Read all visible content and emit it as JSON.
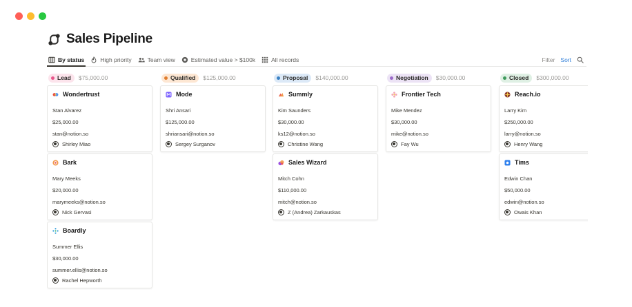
{
  "page": {
    "title": "Sales Pipeline",
    "title_icon": "pipeline-icon"
  },
  "window_controls": {
    "red": "#ff5f57",
    "yellow": "#febc2e",
    "green": "#28c840"
  },
  "views": [
    {
      "label": "By status",
      "icon": "board-icon",
      "active": true
    },
    {
      "label": "High priority",
      "icon": "flame-icon",
      "active": false
    },
    {
      "label": "Team view",
      "icon": "people-icon",
      "active": false
    },
    {
      "label": "Estimated value > $100k",
      "icon": "gear-icon",
      "active": false
    },
    {
      "label": "All records",
      "icon": "grid-icon",
      "active": false
    }
  ],
  "tools": {
    "filter": "Filter",
    "sort": "Sort",
    "search_icon": "search-icon"
  },
  "columns": [
    {
      "status": "Lead",
      "total": "$75,000.00",
      "pill_bg": "#fce4ec",
      "dot": "#e8588c",
      "cards": [
        {
          "name": "Wondertrust",
          "logo": "wondertrust-logo",
          "contact": "Stan Alvarez",
          "value": "$25,000.00",
          "email": "stan@notion.so",
          "owner": "Shirley Miao"
        },
        {
          "name": "Bark",
          "logo": "bark-logo",
          "contact": "Mary Meeks",
          "value": "$20,000.00",
          "email": "marymeeks@notion.so",
          "owner": "Nick Gervasi"
        },
        {
          "name": "Boardly",
          "logo": "boardly-logo",
          "contact": "Summer Ellis",
          "value": "$30,000.00",
          "email": "summer.ellis@notion.so",
          "owner": "Rachel Hepworth"
        }
      ]
    },
    {
      "status": "Qualified",
      "total": "$125,000.00",
      "pill_bg": "#fde7d3",
      "dot": "#e07d2e",
      "cards": [
        {
          "name": "Mode",
          "logo": "mode-logo",
          "contact": "Shri Ansari",
          "value": "$125,000.00",
          "email": "shriansari@notion.so",
          "owner": "Sergey Surganov"
        }
      ]
    },
    {
      "status": "Proposal",
      "total": "$140,000.00",
      "pill_bg": "#dce9f7",
      "dot": "#3b82c4",
      "cards": [
        {
          "name": "Summly",
          "logo": "summly-logo",
          "contact": "Kim Saunders",
          "value": "$30,000.00",
          "email": "ks12@notion.so",
          "owner": "Christine Wang"
        },
        {
          "name": "Sales Wizard",
          "logo": "saleswizard-logo",
          "contact": "Mitch Cohn",
          "value": "$110,000.00",
          "email": "mitch@notion.so",
          "owner": "Z (Andrea) Zarkauskas"
        }
      ]
    },
    {
      "status": "Negotiation",
      "total": "$30,000.00",
      "pill_bg": "#ece3f5",
      "dot": "#9b6bc9",
      "cards": [
        {
          "name": "Frontier Tech",
          "logo": "frontiertech-logo",
          "contact": "Mike Mendez",
          "value": "$30,000.00",
          "email": "mike@notion.so",
          "owner": "Fay Wu"
        }
      ]
    },
    {
      "status": "Closed",
      "total": "$300,000.00",
      "pill_bg": "#dff0e4",
      "dot": "#3f9a5c",
      "cards": [
        {
          "name": "Reach.io",
          "logo": "reachio-logo",
          "contact": "Larry Kim",
          "value": "$250,000.00",
          "email": "larry@notion.so",
          "owner": "Henry Wang"
        },
        {
          "name": "Tims",
          "logo": "tims-logo",
          "contact": "Edwin Chan",
          "value": "$50,000.00",
          "email": "edwin@notion.so",
          "owner": "Owais Khan"
        }
      ]
    }
  ]
}
